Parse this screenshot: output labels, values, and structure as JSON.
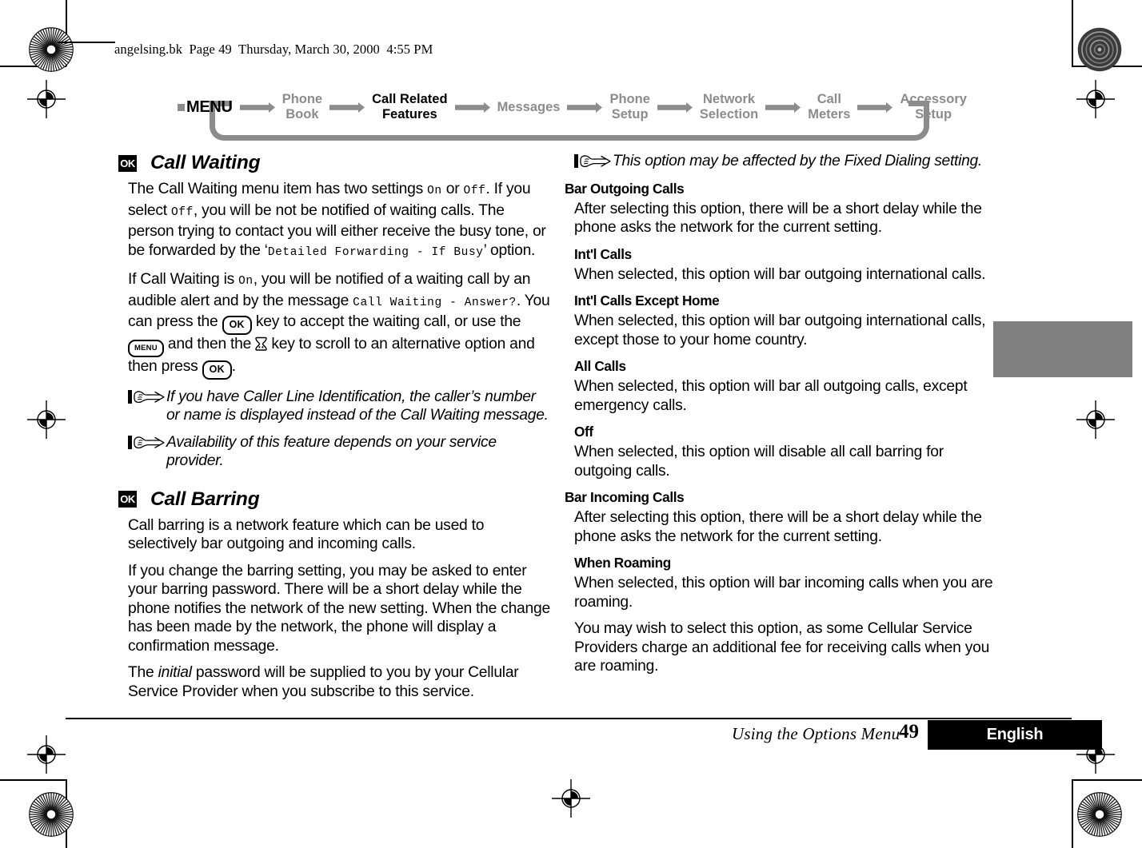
{
  "print_header": {
    "text": "angelsing.bk  Page 49  Thursday, March 30, 2000  4:55 PM"
  },
  "nav": {
    "menu_label": "MENU",
    "items": [
      {
        "label": "Phone\nBook",
        "line1": "Phone",
        "line2": "Book",
        "active": false
      },
      {
        "label": "Call Related\nFeatures",
        "line1": "Call Related",
        "line2": "Features",
        "active": true
      },
      {
        "label": "Messages",
        "line1": "Messages",
        "line2": "",
        "active": false
      },
      {
        "label": "Phone\nSetup",
        "line1": "Phone",
        "line2": "Setup",
        "active": false
      },
      {
        "label": "Network\nSelection",
        "line1": "Network",
        "line2": "Selection",
        "active": false
      },
      {
        "label": "Call\nMeters",
        "line1": "Call",
        "line2": "Meters",
        "active": false
      },
      {
        "label": "Accessory\nSetup",
        "line1": "Accessory",
        "line2": "Setup",
        "active": false
      }
    ],
    "active_color": "#000000",
    "inactive_color": "#8c8c8c"
  },
  "left_column": {
    "call_waiting": {
      "badge": "OK",
      "title": "Call Waiting",
      "p1_a": "The Call Waiting menu item has two settings ",
      "p1_on": "On",
      "p1_b": " or ",
      "p1_off": "Off",
      "p1_c": ". If you select ",
      "p1_off2": "Off",
      "p1_d": ", you will be not be notified of waiting calls. The person trying to contact you will either receive the busy tone, or be forwarded by the ‘",
      "p1_code": "Detailed Forwarding - If Busy",
      "p1_e": "’ option.",
      "p2_a": "If Call Waiting is ",
      "p2_on": "On",
      "p2_b": ", you will be notified of a waiting call by an audible alert and by the message ",
      "p2_msg": "Call Waiting - Answer?",
      "p2_c": ". You can press the ",
      "p2_key_ok": "OK",
      "p2_d": " key to accept the waiting call, or use the ",
      "p2_key_menu": "MENU",
      "p2_e": " and then the ",
      "p2_f": " key to scroll to an alternative option and then press ",
      "p2_key_ok2": "OK",
      "p2_g": ".",
      "note1": "If you have Caller Line Identification, the caller’s number or name is displayed instead of the Call Waiting message.",
      "note2": "Availability of this feature depends on your service provider."
    },
    "call_barring": {
      "badge": "OK",
      "title": "Call Barring",
      "p1": "Call barring is a network feature which can be used to selectively bar outgoing and incoming calls.",
      "p2": "If you change the barring setting, you may be asked to enter your barring password. There will be a short delay while the phone notifies the network of the new setting. When the change has been made by the network, the phone will display a confirmation message.",
      "p3_a": "The ",
      "p3_ital": "initial",
      "p3_b": " password will be supplied to you by your Cellular Service Provider when you subscribe to this service."
    }
  },
  "right_column": {
    "note_fixed_dialing": "This option may be affected by the Fixed Dialing setting.",
    "sections": [
      {
        "heading": "Bar Outgoing Calls",
        "level": 1,
        "body": "After selecting this option, there will be a short delay while the phone asks the network for the current setting."
      },
      {
        "heading": "Int'l Calls",
        "level": 2,
        "body": "When selected, this option will bar outgoing international calls."
      },
      {
        "heading": "Int'l Calls Except Home",
        "level": 2,
        "body": "When selected, this option will bar outgoing international calls, except those to your home country."
      },
      {
        "heading": "All Calls",
        "level": 2,
        "body": "When selected, this option will bar all outgoing calls, except emergency calls."
      },
      {
        "heading": "Off",
        "level": 2,
        "body": "When selected, this option will disable all call barring for outgoing calls."
      },
      {
        "heading": "Bar Incoming Calls",
        "level": 1,
        "body": "After selecting this option, there will be a short delay while the phone asks the network for the current setting."
      },
      {
        "heading": "When Roaming",
        "level": 2,
        "body": "When selected, this option will bar incoming calls when you are roaming."
      }
    ],
    "closing_paragraph": "You may wish to select this option, as some Cellular Service Providers charge an additional fee for receiving calls when you are roaming."
  },
  "footer": {
    "running_head": "Using the Options Menu",
    "page_number": "49",
    "language": "English"
  },
  "chapter_tab": {
    "color": "#808080"
  }
}
